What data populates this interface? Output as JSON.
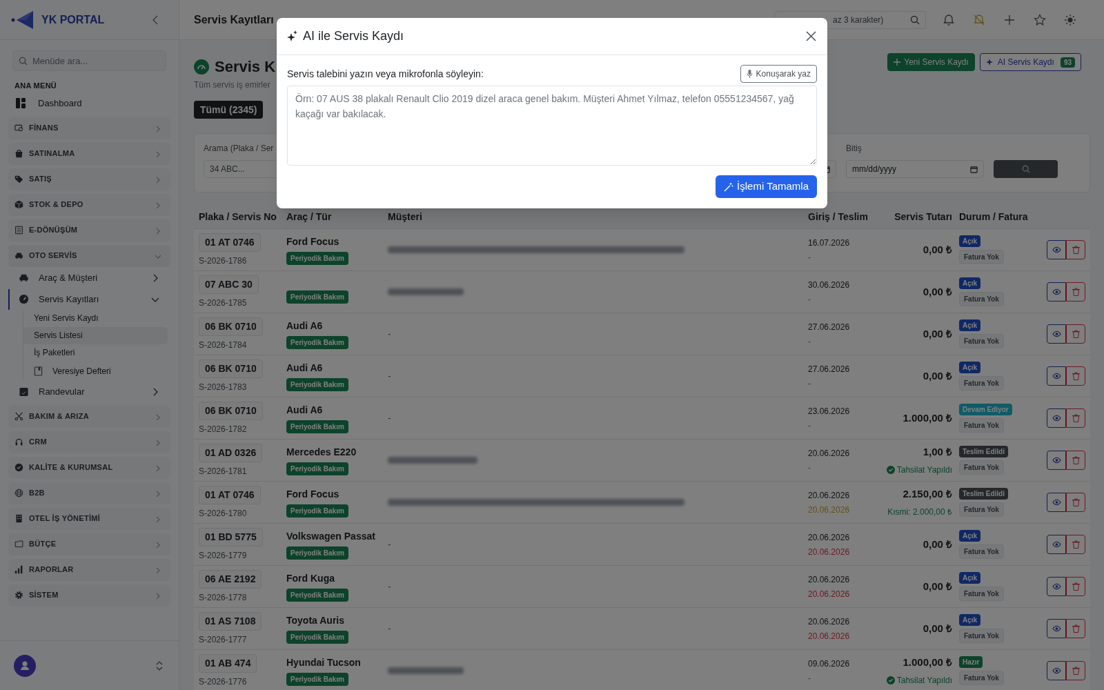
{
  "sidebar": {
    "logo": "YK PORTAL",
    "search": {
      "placeholder": "Menüde ara..."
    },
    "heading": "ANA MENÜ",
    "items": [
      {
        "kind": "link",
        "label": "Dashboard"
      },
      {
        "kind": "section",
        "label": "FİNANS",
        "expanded": false
      },
      {
        "kind": "section",
        "label": "SATINALMA",
        "expanded": false
      },
      {
        "kind": "section",
        "label": "SATIŞ",
        "expanded": false
      },
      {
        "kind": "section",
        "label": "STOK & DEPO",
        "expanded": false
      },
      {
        "kind": "section",
        "label": "E-DÖNÜŞÜM",
        "expanded": false
      },
      {
        "kind": "section",
        "label": "OTO SERVİS",
        "expanded": true,
        "children": [
          {
            "label": "Araç & Müşteri",
            "expanded": false,
            "selected": false
          },
          {
            "label": "Servis Kayıtları",
            "expanded": true,
            "selected": true,
            "children": [
              {
                "label": "Yeni Servis Kaydı",
                "selected": false
              },
              {
                "label": "Servis Listesi",
                "selected": true
              },
              {
                "label": "İş Paketleri",
                "selected": false
              },
              {
                "label": "Veresiye Defteri",
                "selected": false
              }
            ]
          },
          {
            "label": "Randevular",
            "expanded": false,
            "selected": false
          }
        ]
      },
      {
        "kind": "section",
        "label": "BAKIM & ARIZA",
        "expanded": false
      },
      {
        "kind": "section",
        "label": "CRM",
        "expanded": false
      },
      {
        "kind": "section",
        "label": "KALİTE & KURUMSAL",
        "expanded": false
      },
      {
        "kind": "section",
        "label": "B2B",
        "expanded": false
      },
      {
        "kind": "section",
        "label": "OTEL İŞ YÖNETİMİ",
        "expanded": false
      },
      {
        "kind": "section",
        "label": "BÜTÇE",
        "expanded": false
      },
      {
        "kind": "section",
        "label": "RAPORLAR",
        "expanded": false
      },
      {
        "kind": "section",
        "label": "SİSTEM",
        "expanded": false
      }
    ]
  },
  "topbar": {
    "title": "Servis Kayıtları",
    "search": {
      "placeholder": "az 3 karakter)"
    }
  },
  "page": {
    "title": "Servis K",
    "subtitle": "Tüm servis iş emirler",
    "buttons": [
      {
        "kind": "primary",
        "label": "Yeni Servis Kaydı"
      },
      {
        "kind": "ai",
        "label": "AI Servis Kaydı",
        "badge": "93"
      }
    ],
    "tabs": [
      {
        "label": "Tümü (2345)",
        "selected": true
      }
    ],
    "filters": {
      "search_label": "Arama (Plaka / Ser",
      "search_placeholder": "34 ABC...",
      "end_label": "Bitiş",
      "end_placeholder": "mm/dd/yyyy"
    }
  },
  "table": {
    "columns": [
      "Plaka / Servis No",
      "Araç / Tür",
      "Müşteri",
      "Giriş / Teslim",
      "Servis Tutarı",
      "Durum / Fatura"
    ],
    "rows": [
      {
        "plate": "01 AT 0746",
        "service_no": "S-2026-1786",
        "vehicle": "Ford Focus",
        "type": "Periyodik Bakım",
        "customer": {
          "kind": "blurred"
        },
        "entry": "16.07.2026",
        "delivery": "-",
        "overdue": false,
        "amount": "0,00 ₺",
        "status": {
          "kind": "open",
          "label": "Açık"
        },
        "invoice": "Fatura Yok"
      },
      {
        "plate": "07 ABC 30",
        "service_no": "S-2026-1785",
        "type": "Periyodik Bakım",
        "customer": {
          "kind": "blurred"
        },
        "entry": "30.06.2026",
        "delivery": "-",
        "overdue": false,
        "amount": "0,00 ₺",
        "status": {
          "kind": "open",
          "label": "Açık"
        },
        "invoice": "Fatura Yok"
      },
      {
        "plate": "06 BK 0710",
        "service_no": "S-2026-1784",
        "vehicle": "Audi A6",
        "type": "Periyodik Bakım",
        "customer": {
          "kind": "text",
          "text": "-"
        },
        "entry": "27.06.2026",
        "delivery": "-",
        "overdue": false,
        "amount": "0,00 ₺",
        "status": {
          "kind": "open",
          "label": "Açık"
        },
        "invoice": "Fatura Yok"
      },
      {
        "plate": "06 BK 0710",
        "service_no": "S-2026-1783",
        "vehicle": "Audi A6",
        "type": "Periyodik Bakım",
        "customer": {
          "kind": "text",
          "text": "-"
        },
        "entry": "27.06.2026",
        "delivery": "-",
        "overdue": false,
        "amount": "0,00 ₺",
        "status": {
          "kind": "open",
          "label": "Açık"
        },
        "invoice": "Fatura Yok"
      },
      {
        "plate": "06 BK 0710",
        "service_no": "S-2026-1782",
        "vehicle": "Audi A6",
        "type": "Periyodik Bakım",
        "customer": {
          "kind": "text",
          "text": "-"
        },
        "entry": "23.06.2026",
        "delivery": "-",
        "overdue": false,
        "amount": "1.000,00 ₺",
        "status": {
          "kind": "progress",
          "label": "Devam Ediyor"
        },
        "invoice": "Fatura Yok"
      },
      {
        "plate": "01 AD 0326",
        "service_no": "S-2026-1781",
        "vehicle": "Mercedes E220",
        "type": "Periyodik Bakım",
        "customer": {
          "kind": "blurred"
        },
        "entry": "20.06.2026",
        "delivery": "-",
        "overdue": false,
        "amount": "1,00 ₺",
        "payment": {
          "kind": "paid",
          "text": "Tahsilat Yapıldı"
        },
        "status": {
          "kind": "delivered",
          "label": "Teslim Edildi"
        },
        "invoice": "Fatura Yok"
      },
      {
        "plate": "01 AT 0746",
        "service_no": "S-2026-1780",
        "vehicle": "Ford Focus",
        "type": "Periyodik Bakım",
        "customer": {
          "kind": "blurred"
        },
        "entry": "20.06.2026",
        "delivery": "20.06.2026",
        "overdue": false,
        "amount": "2.150,00 ₺",
        "payment": {
          "kind": "partial",
          "text": "Kısmi: 2.000,00 ₺"
        },
        "status": {
          "kind": "delivered",
          "label": "Teslim Edildi"
        },
        "invoice": "Fatura Yok"
      },
      {
        "plate": "01 BD 5775",
        "service_no": "S-2026-1779",
        "vehicle": "Volkswagen Passat",
        "type": "Periyodik Bakım",
        "customer": {
          "kind": "text",
          "text": "-"
        },
        "entry": "20.06.2026",
        "delivery": "20.06.2026",
        "overdue": true,
        "amount": "0,00 ₺",
        "status": {
          "kind": "open",
          "label": "Açık"
        },
        "invoice": "Fatura Yok"
      },
      {
        "plate": "06 AE 2192",
        "service_no": "S-2026-1778",
        "vehicle": "Ford Kuga",
        "type": "Periyodik Bakım",
        "customer": {
          "kind": "text",
          "text": "-"
        },
        "entry": "20.06.2026",
        "delivery": "20.06.2026",
        "overdue": true,
        "amount": "0,00 ₺",
        "status": {
          "kind": "open",
          "label": "Açık"
        },
        "invoice": "Fatura Yok"
      },
      {
        "plate": "01 AS 7108",
        "service_no": "S-2026-1777",
        "vehicle": "Toyota Auris",
        "type": "Periyodik Bakım",
        "customer": {
          "kind": "text",
          "text": "-"
        },
        "entry": "20.06.2026",
        "delivery": "20.06.2026",
        "overdue": true,
        "amount": "0,00 ₺",
        "status": {
          "kind": "open",
          "label": "Açık"
        },
        "invoice": "Fatura Yok"
      },
      {
        "plate": "01 AB 474",
        "service_no": "S-2026-1776",
        "vehicle": "Hyundai Tucson",
        "type": "Periyodik Bakım",
        "customer": {
          "kind": "blurred"
        },
        "entry": "09.06.2026",
        "delivery": "-",
        "overdue": false,
        "amount": "1.000,00 ₺",
        "payment": {
          "kind": "paid",
          "text": "Tahsilat Yapıldı"
        },
        "status": {
          "kind": "ready",
          "label": "Hazır"
        },
        "invoice": "Fatura Yok"
      }
    ]
  },
  "modal": {
    "title": "AI ile Servis Kaydı",
    "prompt_label": "Servis talebini yazın veya mikrofonla söyleyin:",
    "voice_button": "Konuşarak yaz",
    "placeholder": "Örn: 07 AUS 38 plakalı Renault Clio 2019 dizel araca genel bakım. Müşteri Ahmet Yılmaz, telefon 05551234567, yağ kaçağı var bakılacak.",
    "submit": "İşlemi Tamamla"
  }
}
